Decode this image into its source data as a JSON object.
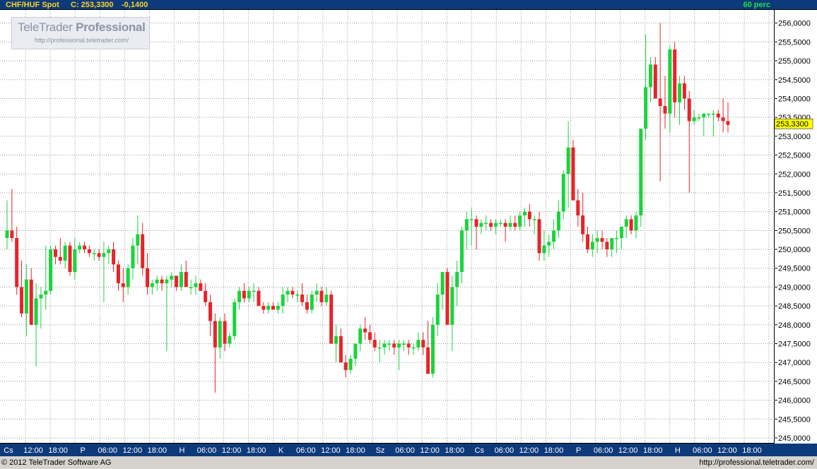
{
  "header": {
    "instrument": "CHF/HUF Spot",
    "close_label": "C: 253,3300",
    "change": "-0,1400",
    "timeframe": "60 perc"
  },
  "logo": {
    "brand_light": "TeleTrader ",
    "brand_bold": "Professional",
    "url": "http://professional.teletrader.com/"
  },
  "footer": {
    "copyright": "© 2012 TeleTrader Software AG",
    "url": "http://professional.teletrader.com/"
  },
  "colors": {
    "up": "#19d43c",
    "down": "#e8232a",
    "frame": "#0d3a7a",
    "accent": "#ffd21e",
    "last_price_marker": "#ffff00"
  },
  "chart_data": {
    "type": "candlestick",
    "series_name": "CHF/HUF Spot",
    "ylim": [
      245.0,
      256.2
    ],
    "y_ticks": [
      "256,0000",
      "255,5000",
      "255,0000",
      "254,5000",
      "254,0000",
      "253,5000",
      "253,0000",
      "252,5000",
      "252,0000",
      "251,5000",
      "251,0000",
      "250,5000",
      "250,0000",
      "249,5000",
      "249,0000",
      "248,5000",
      "248,0000",
      "247,5000",
      "247,0000",
      "246,5000",
      "246,0000",
      "245,5000",
      "245,0000"
    ],
    "last_price_label": "253,3300",
    "last_price": 253.33,
    "x_labels": [
      "Cs",
      "12:00",
      "18:00",
      "P",
      "06:00",
      "12:00",
      "18:00",
      "H",
      "06:00",
      "12:00",
      "18:00",
      "K",
      "06:00",
      "12:00",
      "18:00",
      "Sz",
      "06:00",
      "12:00",
      "18:00",
      "Cs",
      "06:00",
      "12:00",
      "18:00",
      "P",
      "06:00",
      "12:00",
      "18:00",
      "H",
      "06:00",
      "12:00",
      "18:00"
    ],
    "grid": true,
    "candles": [
      [
        250.3,
        251.3,
        250.0,
        250.5
      ],
      [
        250.5,
        251.6,
        250.2,
        250.3
      ],
      [
        250.3,
        250.6,
        248.8,
        249.0
      ],
      [
        249.0,
        249.7,
        248.2,
        248.3
      ],
      [
        248.3,
        249.6,
        247.7,
        249.2
      ],
      [
        249.2,
        249.5,
        248.0,
        248.0
      ],
      [
        248.0,
        249.1,
        246.9,
        248.7
      ],
      [
        248.7,
        249.0,
        247.9,
        248.8
      ],
      [
        248.8,
        250.1,
        248.4,
        248.9
      ],
      [
        248.9,
        250.1,
        248.8,
        250.0
      ],
      [
        250.0,
        250.1,
        249.6,
        249.8
      ],
      [
        249.8,
        250.3,
        249.6,
        249.7
      ],
      [
        249.7,
        250.2,
        249.5,
        250.1
      ],
      [
        250.1,
        250.2,
        249.3,
        249.4
      ],
      [
        249.4,
        250.3,
        249.2,
        250.0
      ],
      [
        250.0,
        250.2,
        249.9,
        250.1
      ],
      [
        250.1,
        250.2,
        249.9,
        250.0
      ],
      [
        250.0,
        250.1,
        249.8,
        249.9
      ],
      [
        249.9,
        250.0,
        249.7,
        249.9
      ],
      [
        249.9,
        250.0,
        249.7,
        249.8
      ],
      [
        249.8,
        250.2,
        248.6,
        249.9
      ],
      [
        249.9,
        250.1,
        249.6,
        250.0
      ],
      [
        250.0,
        250.2,
        249.4,
        249.6
      ],
      [
        249.6,
        249.7,
        248.9,
        249.1
      ],
      [
        249.1,
        249.5,
        248.6,
        249.0
      ],
      [
        249.0,
        249.6,
        248.8,
        249.5
      ],
      [
        249.5,
        250.3,
        249.2,
        250.1
      ],
      [
        250.1,
        250.9,
        249.6,
        250.4
      ],
      [
        250.4,
        250.7,
        249.3,
        249.5
      ],
      [
        249.5,
        249.9,
        248.8,
        249.0
      ],
      [
        249.0,
        249.2,
        248.8,
        249.1
      ],
      [
        249.1,
        249.3,
        248.9,
        249.2
      ],
      [
        249.2,
        249.3,
        248.9,
        249.1
      ],
      [
        249.1,
        249.3,
        247.3,
        249.2
      ],
      [
        249.2,
        249.4,
        249.0,
        249.3
      ],
      [
        249.3,
        249.3,
        248.9,
        249.0
      ],
      [
        249.0,
        249.6,
        248.9,
        249.4
      ],
      [
        249.4,
        249.7,
        249.1,
        249.0
      ],
      [
        249.0,
        249.2,
        248.8,
        249.0
      ],
      [
        249.0,
        249.3,
        248.8,
        249.1
      ],
      [
        249.1,
        249.2,
        248.9,
        248.9
      ],
      [
        248.9,
        249.1,
        248.5,
        248.6
      ],
      [
        248.6,
        248.8,
        247.7,
        248.1
      ],
      [
        248.1,
        248.3,
        246.2,
        247.4
      ],
      [
        247.4,
        248.2,
        247.1,
        248.1
      ],
      [
        248.1,
        248.3,
        247.3,
        247.5
      ],
      [
        247.5,
        247.8,
        247.4,
        247.7
      ],
      [
        247.7,
        248.7,
        247.6,
        248.6
      ],
      [
        248.6,
        249.0,
        248.4,
        248.9
      ],
      [
        248.9,
        249.1,
        248.6,
        248.7
      ],
      [
        248.7,
        249.0,
        248.6,
        248.9
      ],
      [
        248.9,
        249.1,
        248.6,
        248.9
      ],
      [
        248.9,
        249.0,
        248.5,
        248.5
      ],
      [
        248.5,
        248.6,
        248.3,
        248.4
      ],
      [
        248.4,
        248.6,
        248.3,
        248.5
      ],
      [
        248.5,
        248.6,
        248.4,
        248.4
      ],
      [
        248.4,
        248.6,
        248.3,
        248.5
      ],
      [
        248.5,
        249.0,
        248.3,
        248.8
      ],
      [
        248.8,
        249.0,
        248.6,
        248.9
      ],
      [
        248.9,
        249.0,
        248.7,
        248.8
      ],
      [
        248.8,
        248.9,
        248.6,
        248.8
      ],
      [
        248.8,
        249.1,
        248.5,
        248.6
      ],
      [
        248.6,
        248.8,
        248.3,
        248.4
      ],
      [
        248.4,
        248.9,
        248.3,
        248.8
      ],
      [
        248.8,
        249.1,
        248.6,
        248.9
      ],
      [
        248.9,
        249.0,
        248.5,
        248.6
      ],
      [
        248.6,
        249.0,
        248.5,
        248.8
      ],
      [
        248.8,
        248.9,
        247.7,
        247.5
      ],
      [
        247.5,
        248.0,
        247.0,
        247.7
      ],
      [
        247.7,
        247.9,
        247.1,
        247.0
      ],
      [
        247.0,
        247.2,
        246.6,
        246.8
      ],
      [
        246.8,
        247.2,
        246.7,
        247.1
      ],
      [
        247.1,
        247.5,
        246.9,
        247.5
      ],
      [
        247.5,
        248.0,
        247.3,
        247.9
      ],
      [
        247.9,
        248.2,
        247.6,
        247.8
      ],
      [
        247.8,
        248.0,
        247.5,
        247.6
      ],
      [
        247.6,
        247.8,
        247.3,
        247.4
      ],
      [
        247.4,
        247.6,
        247.0,
        247.4
      ],
      [
        247.4,
        247.6,
        247.2,
        247.5
      ],
      [
        247.5,
        247.6,
        247.3,
        247.5
      ],
      [
        247.5,
        247.6,
        247.2,
        247.4
      ],
      [
        247.4,
        247.6,
        246.8,
        247.5
      ],
      [
        247.5,
        247.6,
        247.3,
        247.5
      ],
      [
        247.5,
        247.6,
        247.2,
        247.4
      ],
      [
        247.4,
        247.5,
        247.2,
        247.4
      ],
      [
        247.4,
        247.8,
        247.3,
        247.6
      ],
      [
        247.6,
        247.8,
        247.2,
        247.4
      ],
      [
        247.4,
        248.1,
        246.7,
        246.7
      ],
      [
        246.7,
        248.2,
        246.6,
        248.0
      ],
      [
        248.0,
        249.1,
        247.7,
        248.8
      ],
      [
        248.8,
        249.4,
        248.4,
        249.4
      ],
      [
        249.4,
        249.5,
        248.0,
        248.0
      ],
      [
        248.0,
        249.3,
        247.3,
        249.0
      ],
      [
        249.0,
        249.7,
        248.5,
        249.4
      ],
      [
        249.4,
        250.6,
        249.1,
        250.5
      ],
      [
        250.5,
        251.0,
        250.0,
        250.8
      ],
      [
        250.8,
        251.1,
        250.1,
        250.8
      ],
      [
        250.8,
        250.9,
        250.0,
        250.6
      ],
      [
        250.6,
        250.8,
        250.4,
        250.7
      ],
      [
        250.7,
        250.9,
        250.5,
        250.7
      ],
      [
        250.7,
        250.8,
        250.5,
        250.6
      ],
      [
        250.6,
        250.8,
        250.4,
        250.7
      ],
      [
        250.7,
        250.8,
        250.6,
        250.7
      ],
      [
        250.7,
        250.8,
        250.2,
        250.6
      ],
      [
        250.6,
        250.9,
        250.5,
        250.7
      ],
      [
        250.7,
        250.9,
        250.5,
        250.6
      ],
      [
        250.6,
        251.0,
        250.5,
        250.9
      ],
      [
        250.9,
        251.1,
        250.6,
        251.0
      ],
      [
        251.0,
        251.2,
        250.6,
        250.8
      ],
      [
        250.8,
        250.9,
        250.4,
        250.8
      ],
      [
        250.8,
        251.0,
        249.7,
        249.9
      ],
      [
        249.9,
        250.5,
        249.7,
        250.1
      ],
      [
        250.1,
        250.4,
        249.8,
        250.2
      ],
      [
        250.2,
        250.8,
        250.0,
        250.5
      ],
      [
        250.5,
        251.3,
        250.3,
        251.0
      ],
      [
        251.0,
        252.1,
        250.8,
        252.0
      ],
      [
        252.0,
        253.4,
        251.1,
        252.7
      ],
      [
        252.7,
        252.9,
        251.3,
        251.3
      ],
      [
        251.3,
        251.6,
        250.6,
        250.9
      ],
      [
        250.9,
        251.5,
        250.2,
        250.4
      ],
      [
        250.4,
        250.6,
        249.9,
        250.0
      ],
      [
        250.0,
        250.4,
        249.8,
        250.2
      ],
      [
        250.2,
        250.5,
        249.9,
        250.3
      ],
      [
        250.3,
        250.5,
        250.0,
        250.2
      ],
      [
        250.2,
        250.3,
        249.8,
        250.0
      ],
      [
        250.0,
        250.3,
        249.8,
        250.3
      ],
      [
        250.3,
        250.5,
        249.9,
        250.3
      ],
      [
        250.3,
        250.5,
        250.0,
        250.6
      ],
      [
        250.6,
        250.9,
        250.3,
        250.8
      ],
      [
        250.8,
        250.9,
        250.4,
        250.5
      ],
      [
        250.5,
        251.0,
        250.3,
        250.9
      ],
      [
        250.9,
        251.6,
        250.6,
        253.2
      ],
      [
        253.2,
        255.7,
        252.9,
        254.3
      ],
      [
        254.3,
        255.1,
        253.9,
        254.9
      ],
      [
        254.9,
        255.1,
        254.1,
        254.0
      ],
      [
        254.0,
        256.0,
        251.8,
        253.8
      ],
      [
        253.8,
        254.6,
        253.2,
        253.6
      ],
      [
        253.6,
        255.4,
        253.1,
        255.3
      ],
      [
        255.3,
        255.5,
        253.5,
        253.9
      ],
      [
        253.9,
        254.6,
        253.3,
        254.4
      ],
      [
        254.4,
        254.6,
        253.7,
        254.0
      ],
      [
        254.0,
        254.2,
        251.5,
        253.4
      ],
      [
        253.4,
        253.7,
        253.3,
        253.5
      ],
      [
        253.5,
        253.6,
        253.4,
        253.5
      ],
      [
        253.5,
        253.6,
        253.0,
        253.6
      ],
      [
        253.6,
        253.6,
        253.5,
        253.6
      ],
      [
        253.6,
        253.7,
        253.0,
        253.6
      ],
      [
        253.6,
        253.7,
        253.4,
        253.5
      ],
      [
        253.5,
        254.0,
        253.1,
        253.4
      ],
      [
        253.4,
        253.9,
        253.1,
        253.3
      ]
    ]
  }
}
